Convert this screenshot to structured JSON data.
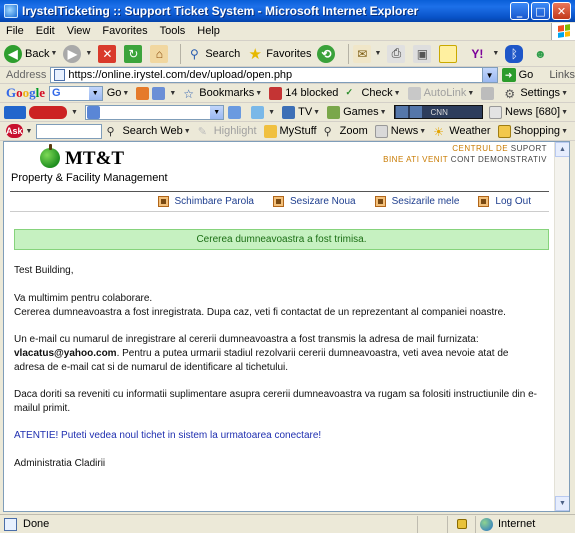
{
  "window": {
    "title": "IrystelTicketing :: Support Ticket System - Microsoft Internet Explorer",
    "min_glyph": "_",
    "max_glyph": "□",
    "close_glyph": "✕"
  },
  "menu": [
    "File",
    "Edit",
    "View",
    "Favorites",
    "Tools",
    "Help"
  ],
  "toolbar": {
    "back": "Back",
    "search": "Search",
    "favorites": "Favorites"
  },
  "address": {
    "label": "Address",
    "url": "https://online.irystel.com/dev/upload/open.php",
    "go": "Go",
    "links": "Links"
  },
  "google": {
    "logo": [
      "G",
      "o",
      "o",
      "g",
      "l",
      "e"
    ],
    "search_value": "G",
    "go": "Go",
    "bookmarks": "Bookmarks",
    "blocked": "14 blocked",
    "check": "Check",
    "autolink": "AutoLink",
    "settings": "Settings"
  },
  "bar3": {
    "tv": "TV",
    "games": "Games",
    "cnn": "CNN",
    "news": "News [680]"
  },
  "ask": {
    "logo": "Ask",
    "search_web": "Search Web",
    "highlight": "Highlight",
    "mystuff": "MyStuff",
    "zoom": "Zoom",
    "news": "News",
    "weather": "Weather",
    "shopping": "Shopping"
  },
  "page": {
    "logo_name": "MT&T",
    "logo_sub": "Property & Facility Management",
    "corner_1_hl": "CENTRUL DE",
    "corner_1_rest": " SUPORT",
    "corner_2_hl": "BINE ATI VENIT",
    "corner_2_rest": " CONT DEMONSTRATIV",
    "nav": [
      "Schimbare Parola",
      "Sesizare Noua",
      "Sesizarile mele",
      "Log Out"
    ],
    "success": "Cererea dumneavoastra a fost trimisa.",
    "greeting": "Test Building,",
    "thanks": "Va multimim pentru colaborare.",
    "registered": "Cererea dumneavoastra a fost inregistrata. Dupa caz, veti fi contactat de un reprezentant al companiei noastre.",
    "email_pre": "Un e-mail cu numarul de inregistrare al cererii dumneavoastra a fost transmis la adresa de mail furnizata: ",
    "email_addr": "vlacatus@yahoo.com",
    "email_post": ". Pentru a putea urmarii stadiul rezolvarii cererii dumneavoastra, veti avea nevoie atat de adresa de e-mail cat si de numarul de identificare al tichetului.",
    "return_info": "Daca doriti sa reveniti cu informatii suplimentare asupra cererii dumneavoastra va rugam sa folositi instructiunile din e-mailul primit.",
    "attention": "ATENTIE! Puteti vedea noul tichet in sistem la urmatoarea conectare!",
    "signature": "Administratia Cladirii"
  },
  "status": {
    "done": "Done",
    "zone": "Internet"
  }
}
